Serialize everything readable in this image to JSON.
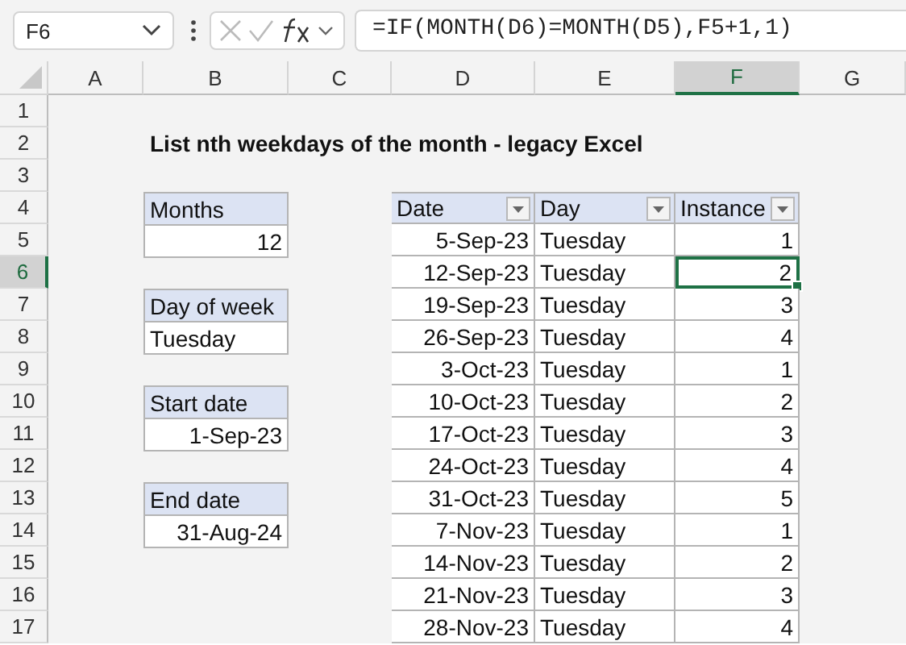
{
  "name_box": "F6",
  "formula": "=IF(MONTH(D6)=MONTH(D5),F5+1,1)",
  "columns": [
    {
      "label": "A",
      "selected": false
    },
    {
      "label": "B",
      "selected": false
    },
    {
      "label": "C",
      "selected": false
    },
    {
      "label": "D",
      "selected": false
    },
    {
      "label": "E",
      "selected": false
    },
    {
      "label": "F",
      "selected": true
    },
    {
      "label": "G",
      "selected": false
    }
  ],
  "rows": [
    {
      "label": "1",
      "selected": false
    },
    {
      "label": "2",
      "selected": false
    },
    {
      "label": "3",
      "selected": false
    },
    {
      "label": "4",
      "selected": false
    },
    {
      "label": "5",
      "selected": false
    },
    {
      "label": "6",
      "selected": true
    },
    {
      "label": "7",
      "selected": false
    },
    {
      "label": "8",
      "selected": false
    },
    {
      "label": "9",
      "selected": false
    },
    {
      "label": "10",
      "selected": false
    },
    {
      "label": "11",
      "selected": false
    },
    {
      "label": "12",
      "selected": false
    },
    {
      "label": "13",
      "selected": false
    },
    {
      "label": "14",
      "selected": false
    },
    {
      "label": "15",
      "selected": false
    },
    {
      "label": "16",
      "selected": false
    },
    {
      "label": "17",
      "selected": false
    }
  ],
  "title": "List nth weekdays of the month - legacy Excel",
  "inputs": [
    {
      "label": "Months",
      "value": "12",
      "kind": "number"
    },
    {
      "label": "Day of week",
      "value": "Tuesday",
      "kind": "text"
    },
    {
      "label": "Start date",
      "value": "1-Sep-23",
      "kind": "number"
    },
    {
      "label": "End date",
      "value": "31-Aug-24",
      "kind": "number"
    }
  ],
  "table": {
    "columns": [
      "Date",
      "Day",
      "Instance"
    ],
    "rows": [
      {
        "date": "5-Sep-23",
        "day": "Tuesday",
        "instance": "1",
        "selected": false
      },
      {
        "date": "12-Sep-23",
        "day": "Tuesday",
        "instance": "2",
        "selected": true
      },
      {
        "date": "19-Sep-23",
        "day": "Tuesday",
        "instance": "3",
        "selected": false
      },
      {
        "date": "26-Sep-23",
        "day": "Tuesday",
        "instance": "4",
        "selected": false
      },
      {
        "date": "3-Oct-23",
        "day": "Tuesday",
        "instance": "1",
        "selected": false
      },
      {
        "date": "10-Oct-23",
        "day": "Tuesday",
        "instance": "2",
        "selected": false
      },
      {
        "date": "17-Oct-23",
        "day": "Tuesday",
        "instance": "3",
        "selected": false
      },
      {
        "date": "24-Oct-23",
        "day": "Tuesday",
        "instance": "4",
        "selected": false
      },
      {
        "date": "31-Oct-23",
        "day": "Tuesday",
        "instance": "5",
        "selected": false
      },
      {
        "date": "7-Nov-23",
        "day": "Tuesday",
        "instance": "1",
        "selected": false
      },
      {
        "date": "14-Nov-23",
        "day": "Tuesday",
        "instance": "2",
        "selected": false
      },
      {
        "date": "21-Nov-23",
        "day": "Tuesday",
        "instance": "3",
        "selected": false
      },
      {
        "date": "28-Nov-23",
        "day": "Tuesday",
        "instance": "4",
        "selected": false
      }
    ]
  }
}
